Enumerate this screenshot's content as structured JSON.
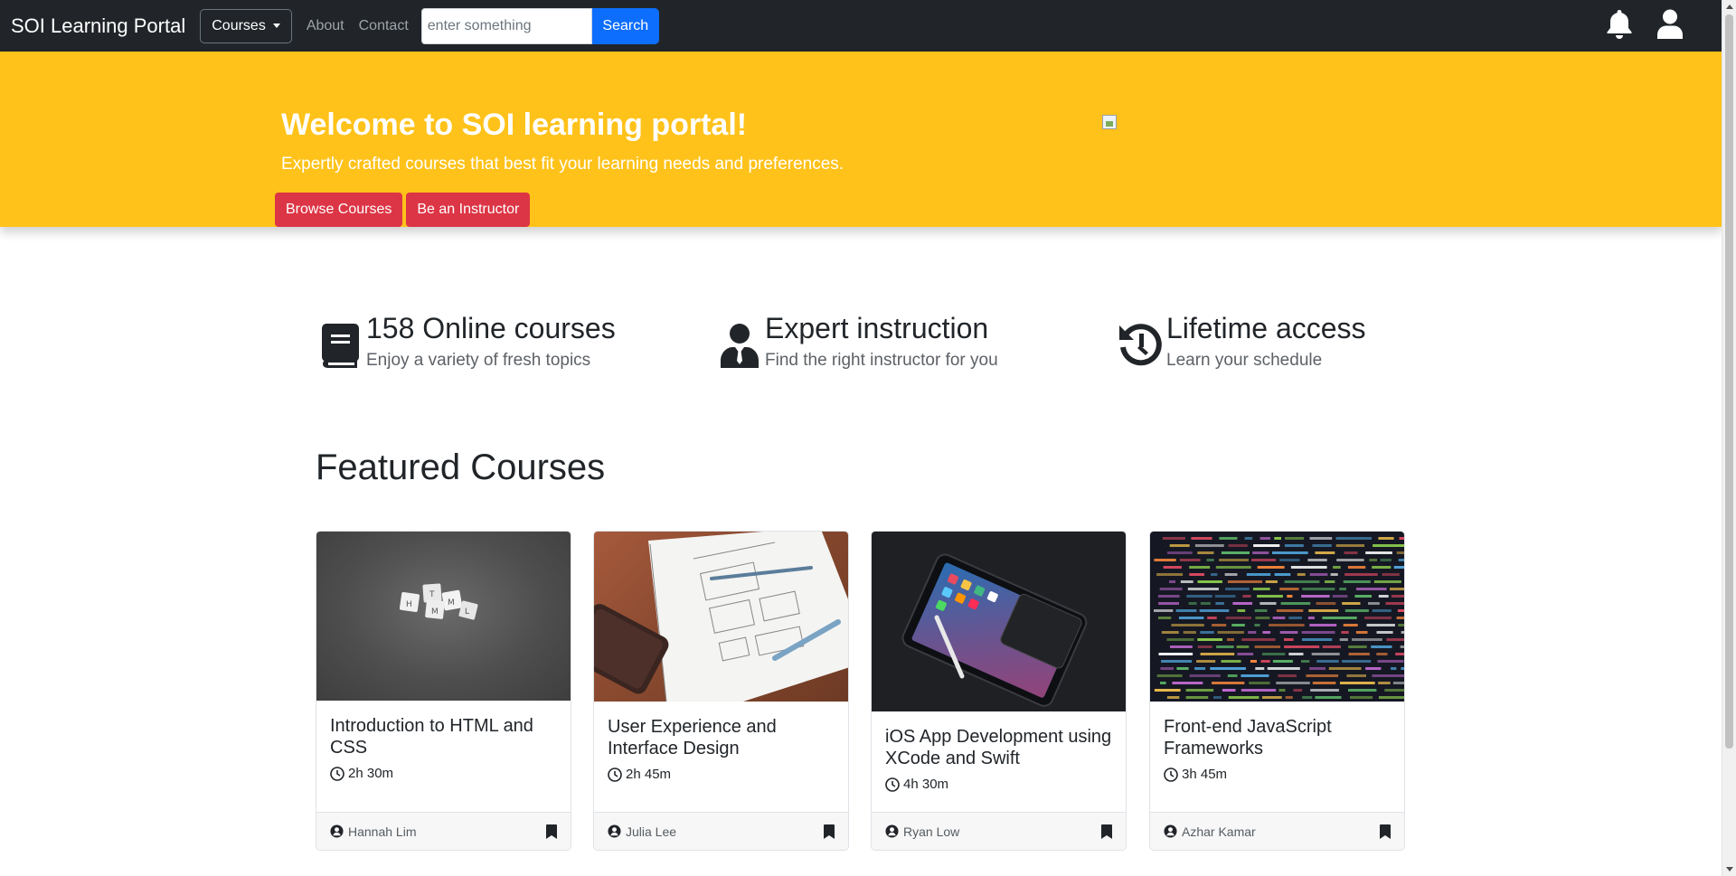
{
  "navbar": {
    "brand": "SOI Learning Portal",
    "courses_dropdown": "Courses",
    "links": [
      "About",
      "Contact"
    ],
    "search_placeholder": "enter something",
    "search_button": "Search",
    "icons": [
      "bell-icon",
      "user-icon"
    ]
  },
  "hero": {
    "title": "Welcome to SOI learning portal!",
    "subtitle": "Expertly crafted courses that best fit your learning needs and preferences.",
    "buttons": [
      "Browse Courses",
      "Be an Instructor"
    ],
    "background_color": "#ffc21a"
  },
  "features": [
    {
      "icon": "book-icon",
      "title": "158 Online courses",
      "subtitle": "Enjoy a variety of fresh topics"
    },
    {
      "icon": "instructor-icon",
      "title": "Expert instruction",
      "subtitle": "Find the right instructor for you"
    },
    {
      "icon": "history-icon",
      "title": "Lifetime access",
      "subtitle": "Learn your schedule"
    }
  ],
  "featured": {
    "heading": "Featured Courses",
    "courses": [
      {
        "title": "Introduction to HTML and CSS",
        "duration": "2h 30m",
        "author": "Hannah Lim",
        "image": "html-scrabble-tiles"
      },
      {
        "title": "User Experience and Interface Design",
        "duration": "2h 45m",
        "author": "Julia Lee",
        "image": "wireframe-sketch-notebook"
      },
      {
        "title": "iOS App Development using XCode and Swift",
        "duration": "4h 30m",
        "author": "Ryan Low",
        "image": "ipad-and-pencil"
      },
      {
        "title": "Front-end JavaScript Frameworks",
        "duration": "3h 45m",
        "author": "Azhar Kamar",
        "image": "code-on-screen"
      }
    ]
  },
  "colors": {
    "navbar": "#212529",
    "primary": "#0d6efd",
    "danger": "#dc3545",
    "warning": "#ffc21a"
  }
}
